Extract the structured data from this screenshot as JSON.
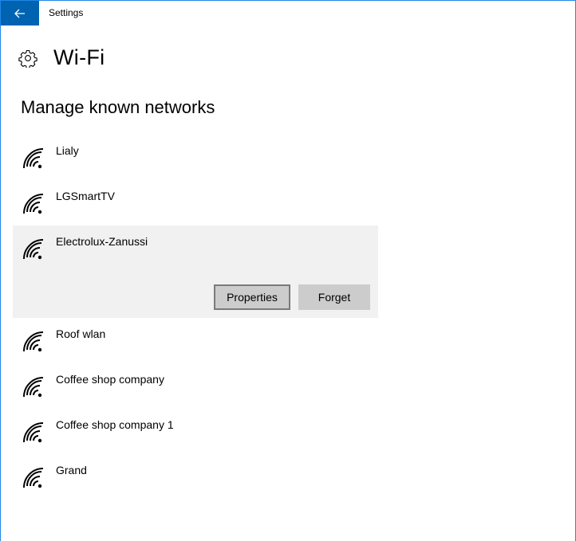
{
  "window": {
    "title": "Settings"
  },
  "header": {
    "title": "Wi-Fi",
    "icon": "gear-icon"
  },
  "section": {
    "title": "Manage known networks"
  },
  "networks": [
    {
      "name": "Lialy"
    },
    {
      "name": "LGSmartTV"
    },
    {
      "name": "Electrolux-Zanussi"
    },
    {
      "name": "Roof wlan"
    },
    {
      "name": "Coffee shop company"
    },
    {
      "name": "Coffee shop company 1"
    },
    {
      "name": "Grand"
    }
  ],
  "selected_actions": {
    "properties_label": "Properties",
    "forget_label": "Forget"
  },
  "colors": {
    "accent": "#0063b1",
    "selected_bg": "#f1f1f1",
    "button_bg": "#cccccc"
  }
}
